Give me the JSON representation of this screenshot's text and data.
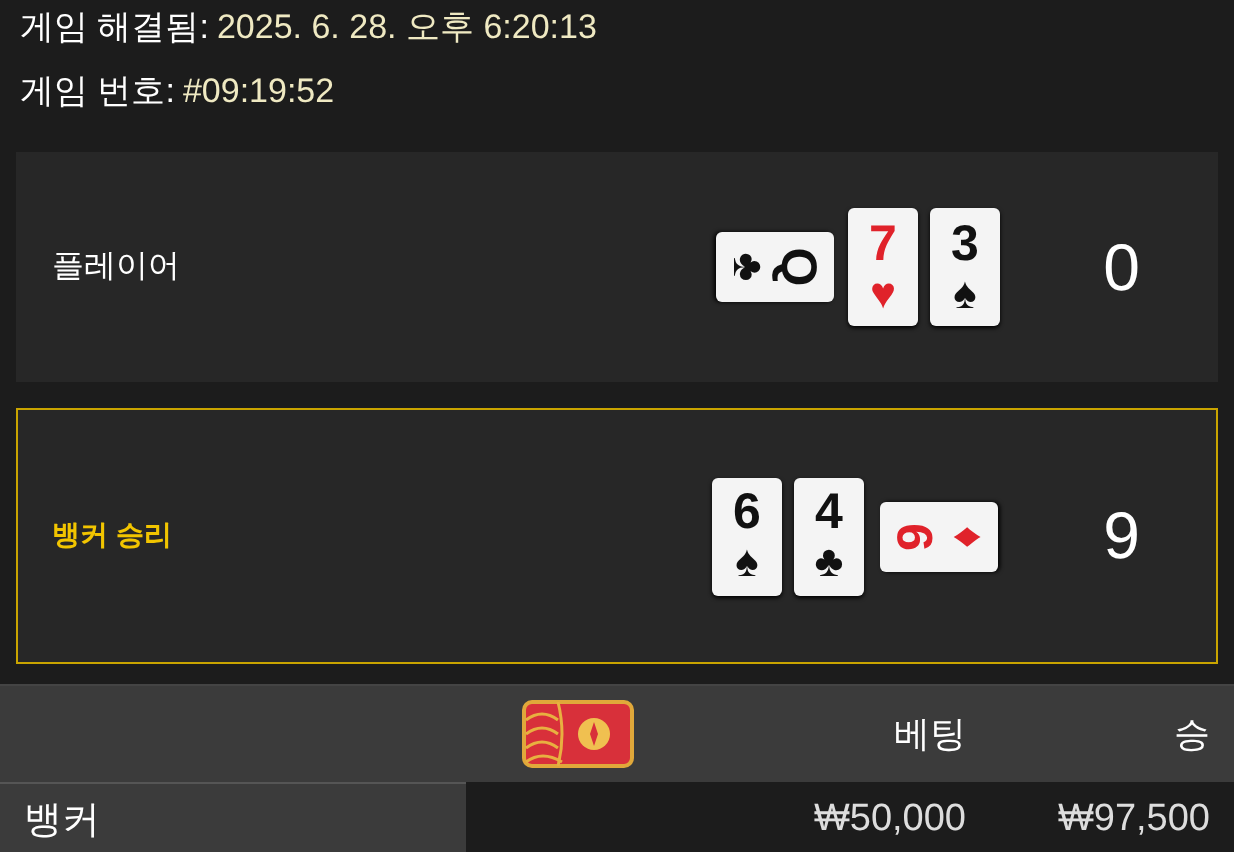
{
  "info": [
    {
      "label": "게임 해결됨:",
      "value": "2025. 6. 28. 오후 6:20:13"
    },
    {
      "label": "게임 번호:",
      "value": "#09:19:52"
    }
  ],
  "hands": [
    {
      "label": "플레이어",
      "winner": false,
      "score": "0",
      "cards": [
        {
          "rank": "Q",
          "suit": "♣",
          "color": "#111111",
          "kind": "clockwise"
        },
        {
          "rank": "7",
          "suit": "♥",
          "color": "#e0222a",
          "kind": "upright"
        },
        {
          "rank": "3",
          "suit": "♠",
          "color": "#111111",
          "kind": "upright"
        }
      ]
    },
    {
      "label": "뱅커 승리",
      "winner": true,
      "score": "9",
      "cards": [
        {
          "rank": "6",
          "suit": "♠",
          "color": "#111111",
          "kind": "upright"
        },
        {
          "rank": "4",
          "suit": "♣",
          "color": "#111111",
          "kind": "upright"
        },
        {
          "rank": "9",
          "suit": "♦",
          "color": "#e0222a",
          "kind": "counterclockwise"
        }
      ]
    }
  ],
  "bets": {
    "columns": [
      "베팅",
      "승"
    ],
    "rows": [
      {
        "name": "뱅커",
        "bet": "₩50,000",
        "win": "₩97,500"
      }
    ]
  }
}
